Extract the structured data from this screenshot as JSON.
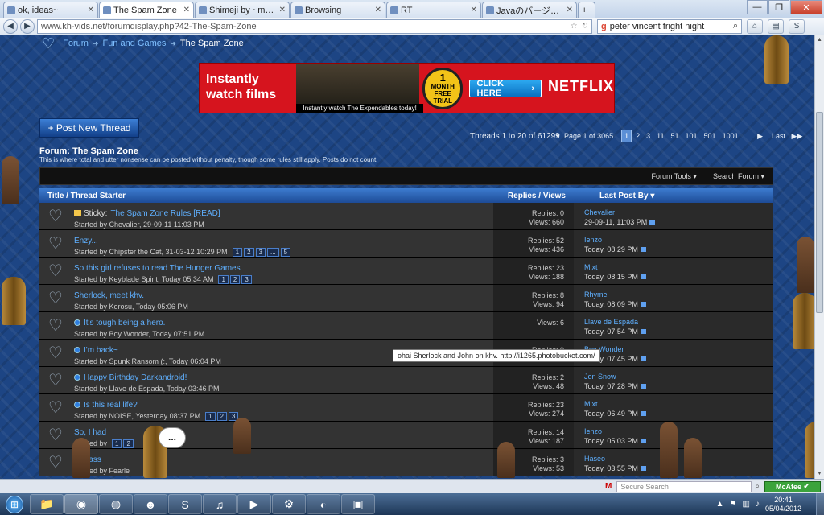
{
  "browser": {
    "tabs": [
      {
        "title": "ok, ideas~"
      },
      {
        "title": "The Spam Zone"
      },
      {
        "title": "Shimeji by ~masyankaya"
      },
      {
        "title": "Browsing"
      },
      {
        "title": "RT"
      },
      {
        "title": "Javaのバージョンの確認"
      }
    ],
    "url": "www.kh-vids.net/forumdisplay.php?42-The-Spam-Zone",
    "search_text": "peter vincent fright night"
  },
  "breadcrumb": {
    "items": [
      "Forum",
      "Fun and Games"
    ],
    "current": "The Spam Zone"
  },
  "ad": {
    "headline": "Instantly watch films",
    "caption": "Instantly watch The Expendables today!",
    "trial_top": "1",
    "trial_mid": "MONTH",
    "trial_bottom": "FREE TRIAL",
    "cta": "CLICK HERE",
    "brand": "NETFLIX"
  },
  "forum": {
    "post_button": "+ Post New Thread",
    "thread_count": "Threads 1 to 20 of 61299",
    "page_label": "Page 1 of 3065",
    "pages": [
      "1",
      "2",
      "3",
      "11",
      "51",
      "101",
      "501",
      "1001",
      "...",
      "Last"
    ],
    "title": "Forum: The Spam Zone",
    "description": "This is where total and utter nonsense can be posted without penalty, though some rules still apply. Posts do not count.",
    "tools": [
      "Forum Tools",
      "Search Forum"
    ],
    "columns": {
      "title": "Title / Thread Starter",
      "stats": "Replies / Views",
      "last": "Last Post By"
    }
  },
  "threads": [
    {
      "sticky": "Sticky:",
      "title": "The Spam Zone Rules [READ]",
      "meta": "Started by Chevalier, 29-09-11 11:03 PM",
      "pages": [],
      "replies": "Replies: 0",
      "views": "Views: 660",
      "last_by": "Chevalier",
      "last_when": "29-09-11, 11:03 PM"
    },
    {
      "sticky": "",
      "title": "Enzy...",
      "meta": "Started by Chipster the Cat, 31-03-12 10:29 PM",
      "pages": [
        "1",
        "2",
        "3",
        "...",
        "5"
      ],
      "replies": "Replies: 52",
      "views": "Views: 436",
      "last_by": "Ienzo",
      "last_when": "Today, 08:29 PM"
    },
    {
      "sticky": "",
      "title": "So this girl refuses to read The Hunger Games",
      "meta": "Started by Keyblade Spirit, Today 05:34 AM",
      "pages": [
        "1",
        "2",
        "3"
      ],
      "replies": "Replies: 23",
      "views": "Views: 188",
      "last_by": "Mixt",
      "last_when": "Today, 08:15 PM"
    },
    {
      "sticky": "",
      "title": "Sherlock, meet khv.",
      "meta": "Started by Korosu, Today 05:06 PM",
      "pages": [],
      "replies": "Replies: 8",
      "views": "Views: 94",
      "last_by": "Rhyme",
      "last_when": "Today, 08:09 PM"
    },
    {
      "sticky": "",
      "title": "It's tough being a hero.",
      "meta": "Started by Boy Wonder, Today 07:51 PM",
      "pages": [],
      "replies": "",
      "views": "Views: 6",
      "last_by": "Llave de Espada",
      "last_when": "Today, 07:54 PM"
    },
    {
      "sticky": "",
      "title": "I'm back~",
      "meta": "Started by Spunk Ransom (:, Today 06:04 PM",
      "pages": [],
      "replies": "Replies: 9",
      "views": "Views: 84",
      "last_by": "Boy Wonder",
      "last_when": "Today, 07:45 PM"
    },
    {
      "sticky": "",
      "title": "Happy Birthday Darkandroid!",
      "meta": "Started by Llave de Espada, Today 03:46 PM",
      "pages": [],
      "replies": "Replies: 2",
      "views": "Views: 48",
      "last_by": "Jon Snow",
      "last_when": "Today, 07:28 PM"
    },
    {
      "sticky": "",
      "title": "Is this real life?",
      "meta": "Started by NOISE, Yesterday 08:37 PM",
      "pages": [
        "1",
        "2",
        "3"
      ],
      "replies": "Replies: 23",
      "views": "Views: 274",
      "last_by": "Mixt",
      "last_when": "Today, 06:49 PM"
    },
    {
      "sticky": "",
      "title": "So, I had",
      "meta": "Started by",
      "pages": [
        "1",
        "2"
      ],
      "replies": "Replies: 14",
      "views": "Views: 187",
      "last_by": "Ienzo",
      "last_when": "Today, 05:03 PM"
    },
    {
      "sticky": "",
      "title": "to class",
      "meta": "Started by Fearle",
      "pages": [],
      "replies": "Replies: 3",
      "views": "Views: 53",
      "last_by": "Haseo",
      "last_when": "Today, 03:55 PM"
    }
  ],
  "tooltip": "ohai Sherlock and John on khv.  http://i1265.photobucket.com/",
  "bubble": "...",
  "statusbar": {
    "search_placeholder": "Secure Search",
    "mcafee": "McAfee"
  },
  "clock": {
    "time": "20:41",
    "date": "05/04/2012"
  }
}
